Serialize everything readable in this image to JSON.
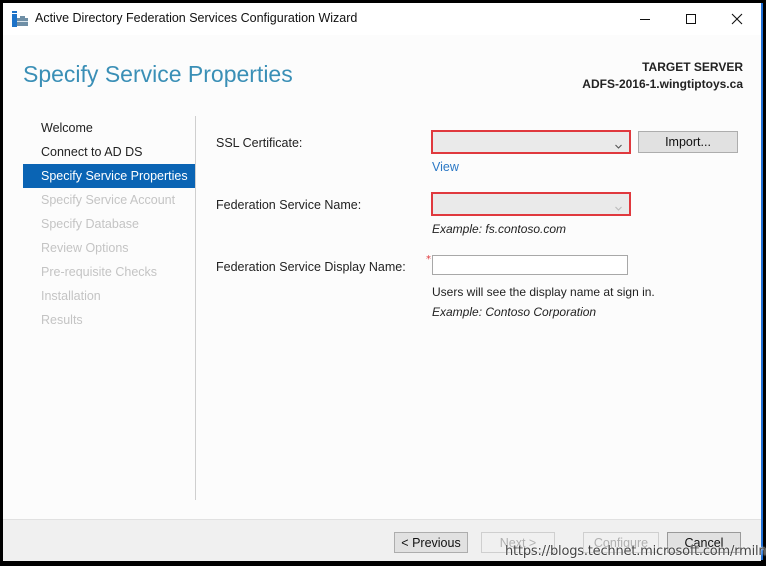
{
  "window": {
    "title": "Active Directory Federation Services Configuration Wizard",
    "controls": {
      "minimize": "minimize",
      "maximize": "maximize",
      "close": "close"
    }
  },
  "header": {
    "page_title": "Specify Service Properties",
    "target_server_label": "TARGET SERVER",
    "target_server_name": "ADFS-2016-1.wingtiptoys.ca"
  },
  "nav": {
    "items": [
      {
        "label": "Welcome",
        "state": "completed"
      },
      {
        "label": "Connect to AD DS",
        "state": "completed"
      },
      {
        "label": "Specify Service Properties",
        "state": "active"
      },
      {
        "label": "Specify Service Account",
        "state": "disabled"
      },
      {
        "label": "Specify Database",
        "state": "disabled"
      },
      {
        "label": "Review Options",
        "state": "disabled"
      },
      {
        "label": "Pre-requisite Checks",
        "state": "disabled"
      },
      {
        "label": "Installation",
        "state": "disabled"
      },
      {
        "label": "Results",
        "state": "disabled"
      }
    ]
  },
  "form": {
    "ssl_certificate": {
      "label": "SSL Certificate:",
      "value": "",
      "import_label": "Import...",
      "view_label": "View"
    },
    "federation_service_name": {
      "label": "Federation Service Name:",
      "value": "",
      "example": "Example: fs.contoso.com"
    },
    "display_name": {
      "label": "Federation Service Display Name:",
      "value": "",
      "required_marker": "*",
      "hint": "Users will see the display name at sign in.",
      "example": "Example: Contoso Corporation"
    }
  },
  "footer": {
    "previous_label": "< Previous",
    "next_label": "Next >",
    "configure_label": "Configure",
    "cancel_label": "Cancel"
  },
  "watermark": "https://blogs.technet.microsoft.com/rmilne",
  "colors": {
    "accent": "#0a64b4",
    "title": "#3a8fb6",
    "error_border": "#e0393e",
    "link": "#2b78c5"
  }
}
